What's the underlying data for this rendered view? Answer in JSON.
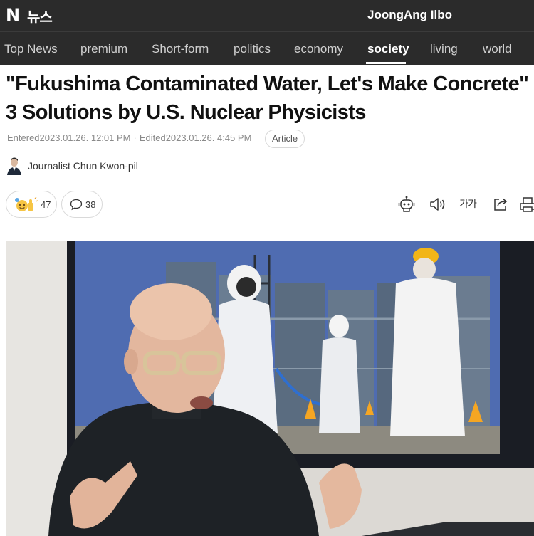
{
  "header": {
    "logo": "N",
    "service": "뉴스",
    "press": "JoongAng Ilbo"
  },
  "nav": {
    "items": [
      {
        "label": "Top News",
        "active": false
      },
      {
        "label": "premium",
        "active": false
      },
      {
        "label": "Short-form",
        "active": false
      },
      {
        "label": "politics",
        "active": false
      },
      {
        "label": "economy",
        "active": false
      },
      {
        "label": "society",
        "active": true
      },
      {
        "label": "living",
        "active": false
      },
      {
        "label": "world",
        "active": false
      }
    ]
  },
  "article": {
    "headline_line1": "\"Fukushima Contaminated Water, Let's Make Concrete\"",
    "headline_line2": "3 Solutions by U.S. Nuclear Physicists",
    "entered_label": "Entered",
    "entered": "2023.01.26. 12:01 PM",
    "edited_label": "Edited",
    "edited": "2023.01.26. 4:45 PM",
    "type_badge": "Article",
    "journalist": "Journalist Chun Kwon-pil"
  },
  "reactions": {
    "count": "47",
    "comments": "38"
  },
  "tools": {
    "summary_icon": "robot-icon",
    "audio_icon": "speaker-icon",
    "font_size_label": "가가",
    "share_icon": "share-icon",
    "print_icon": "print-icon"
  },
  "colors": {
    "header_bg": "#2b2b2b",
    "text": "#111111",
    "meta": "#8a8a8a"
  }
}
